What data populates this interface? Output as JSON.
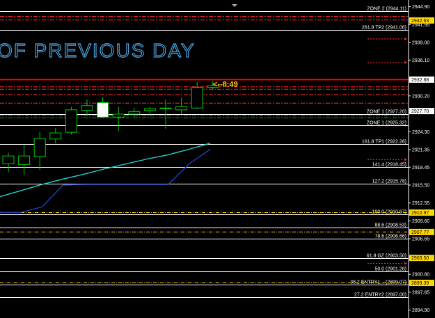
{
  "watermark": "OF PREVIOUS DAY",
  "timer": "<--8:49",
  "colors": {
    "background": "#000000",
    "bull": "#ffffff",
    "bear": "#000000",
    "wick": "#00cc00",
    "level_line": "#ffffff",
    "red_line": "#ff0000",
    "red_dash": "#ff2a2a",
    "green_dash": "#00aa00",
    "yellow_dash": "#ffd700",
    "ma_cyan": "#22d3d3",
    "ma_blue": "#1f3fbf",
    "tag_yellow": "#ffd700",
    "tag_white": "#ffffff"
  },
  "axis_ticks": [
    {
      "label": "2944.90",
      "price": 2944.9
    },
    {
      "label": "2941.95",
      "price": 2941.95
    },
    {
      "label": "2939.00",
      "price": 2939.0
    },
    {
      "label": "2936.10",
      "price": 2936.1
    },
    {
      "label": "2930.20",
      "price": 2930.2
    },
    {
      "label": "2924.30",
      "price": 2924.3
    },
    {
      "label": "2921.35",
      "price": 2921.35
    },
    {
      "label": "2918.45",
      "price": 2918.45
    },
    {
      "label": "2915.50",
      "price": 2915.5
    },
    {
      "label": "2912.55",
      "price": 2912.55
    },
    {
      "label": "2909.60",
      "price": 2909.6
    },
    {
      "label": "2906.65",
      "price": 2906.65
    },
    {
      "label": "2900.80",
      "price": 2900.8
    },
    {
      "label": "2897.85",
      "price": 2897.85
    },
    {
      "label": "2894.90",
      "price": 2894.9
    }
  ],
  "price_tags": [
    {
      "label": "2942.63",
      "price": 2942.63,
      "color": "#ffd700"
    },
    {
      "label": "2932.88",
      "price": 2932.88,
      "color": "#ffffff"
    },
    {
      "label": "2927.70",
      "price": 2927.7,
      "color": "#ffffff"
    },
    {
      "label": "2910.97",
      "price": 2910.97,
      "color": "#ffd700"
    },
    {
      "label": "2907.77",
      "price": 2907.77,
      "color": "#ffd700"
    },
    {
      "label": "2903.50",
      "price": 2903.5,
      "color": "#ffd700"
    },
    {
      "label": "2899.39",
      "price": 2899.39,
      "color": "#ffd700"
    }
  ],
  "levels": [
    {
      "label": "ZONE 2   (2944.11)",
      "price": 2944.11
    },
    {
      "label": "261.8 TP2   (2941.06)",
      "price": 2941.06
    },
    {
      "label": "ZONE 1   (2927.20)",
      "price": 2927.2
    },
    {
      "label": "ZONE 1   (2925.32)",
      "price": 2925.32
    },
    {
      "label": "161.8 TP1   (2922.28)",
      "price": 2922.28
    },
    {
      "label": "141.4   (2918.45)",
      "price": 2918.45
    },
    {
      "label": "127.2   (2915.78)",
      "price": 2915.78
    },
    {
      "label": "100.0   (2910.67)",
      "price": 2910.67
    },
    {
      "label": "88.6   (2908.53)",
      "price": 2908.53
    },
    {
      "label": "78.6   (2906.66)",
      "price": 2906.66
    },
    {
      "label": "61.8 GZ   (2903.50)",
      "price": 2903.5
    },
    {
      "label": "50.0   (2901.28)",
      "price": 2901.28
    },
    {
      "label": "38.2 ENTRY1...   (2899.07)",
      "price": 2899.07
    },
    {
      "label": "27.2 ENTRY2   (2897.00)",
      "price": 2897.0
    }
  ],
  "chart_data": {
    "type": "candlestick",
    "ylim": [
      2893.6,
      2946.0
    ],
    "candles": [
      {
        "open": 2919.0,
        "high": 2920.8,
        "low": 2917.6,
        "close": 2920.3
      },
      {
        "open": 2918.9,
        "high": 2922.2,
        "low": 2917.2,
        "close": 2920.3
      },
      {
        "open": 2920.2,
        "high": 2924.2,
        "low": 2918.0,
        "close": 2923.2
      },
      {
        "open": 2923.1,
        "high": 2924.9,
        "low": 2922.4,
        "close": 2924.1
      },
      {
        "open": 2924.2,
        "high": 2928.4,
        "low": 2923.8,
        "close": 2927.9
      },
      {
        "open": 2927.8,
        "high": 2929.6,
        "low": 2926.9,
        "close": 2928.6
      },
      {
        "open": 2929.1,
        "high": 2930.0,
        "low": 2926.7,
        "close": 2926.7
      },
      {
        "open": 2926.7,
        "high": 2928.4,
        "low": 2924.4,
        "close": 2927.2
      },
      {
        "open": 2927.2,
        "high": 2928.2,
        "low": 2926.7,
        "close": 2927.6
      },
      {
        "open": 2927.8,
        "high": 2928.4,
        "low": 2926.9,
        "close": 2928.1
      },
      {
        "open": 2928.1,
        "high": 2929.6,
        "low": 2924.8,
        "close": 2928.2
      },
      {
        "open": 2927.9,
        "high": 2929.9,
        "low": 2927.2,
        "close": 2928.4
      },
      {
        "open": 2928.2,
        "high": 2932.5,
        "low": 2928.0,
        "close": 2931.6
      },
      {
        "open": 2931.6,
        "high": 2932.7,
        "low": 2931.2,
        "close": 2931.9
      }
    ],
    "ma_cyan": [
      2913.6,
      2914.6,
      2915.6,
      2916.5,
      2917.3,
      2918.2,
      2919.0,
      2919.8,
      2920.5,
      2921.4,
      2922.4
    ],
    "ma_blue": [
      2911.0,
      2911.0,
      2911.9,
      2915.5,
      2915.6,
      2915.6,
      2915.6,
      2915.6,
      2915.6,
      2919.0,
      2921.4
    ],
    "red_lines": [
      2932.88
    ],
    "red_dashed": [
      2943.3,
      2942.7,
      2931.7,
      2931.3,
      2930.4,
      2929.0
    ],
    "green_dashed": [
      2927.0,
      2926.6
    ],
    "yellow_dashed": [
      2910.97,
      2907.77,
      2899.39
    ],
    "red_dotted_marks": [
      2939.6,
      2935.7,
      2919.7,
      2902.6
    ]
  }
}
